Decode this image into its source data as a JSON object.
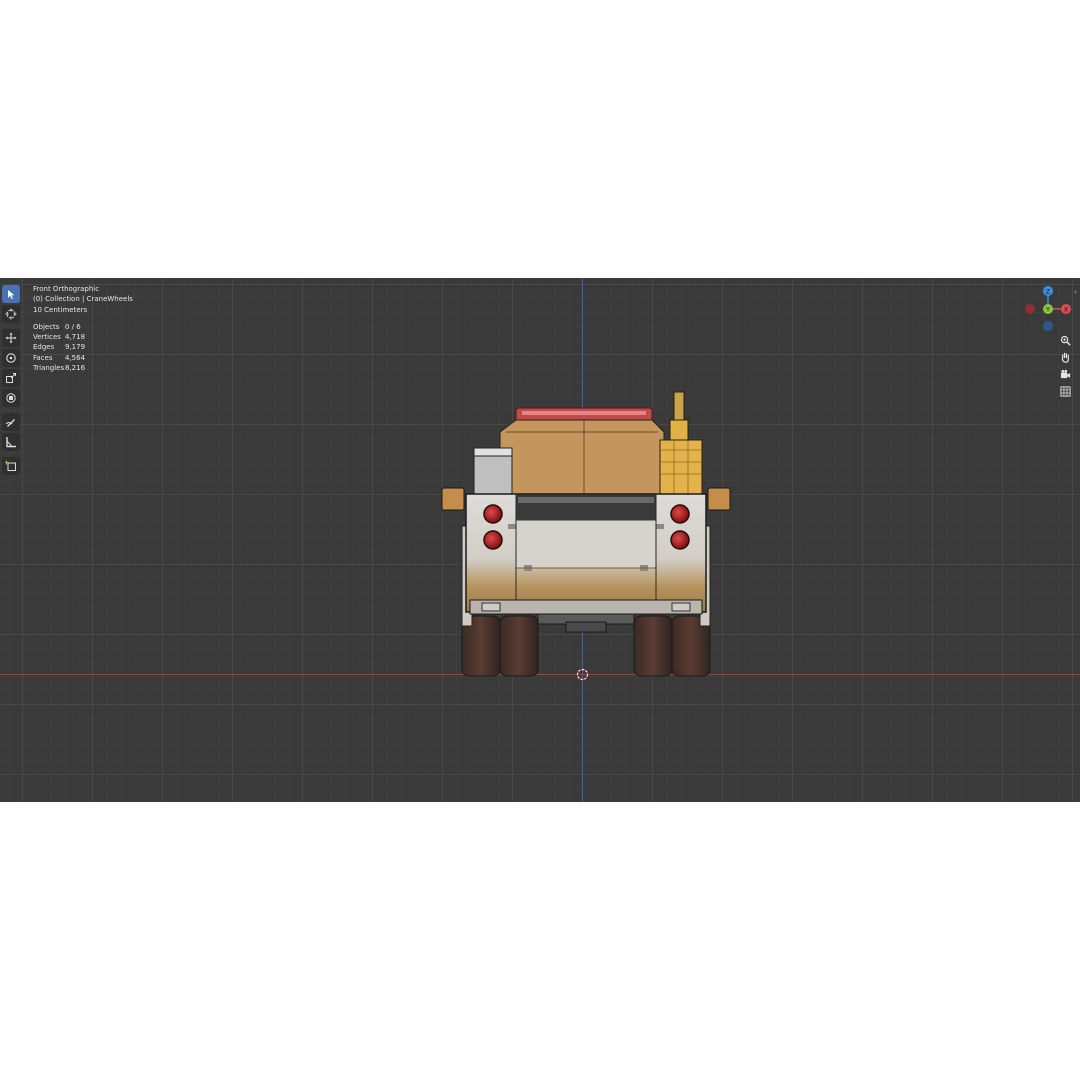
{
  "viewport": {
    "view_name": "Front Orthographic",
    "collection": "(0) Collection | CraneWheels",
    "scale": "10 Centimeters",
    "stats": [
      {
        "label": "Objects",
        "value": "0 / 6"
      },
      {
        "label": "Vertices",
        "value": "4,718"
      },
      {
        "label": "Edges",
        "value": "9,179"
      },
      {
        "label": "Faces",
        "value": "4,564"
      },
      {
        "label": "Triangles",
        "value": "8,216"
      }
    ]
  },
  "toolbar": {
    "tools": [
      "select-box-icon",
      "cursor-icon",
      "move-icon",
      "rotate-icon",
      "scale-icon",
      "transform-icon",
      "annotate-icon",
      "measure-icon",
      "add-cube-icon"
    ],
    "active": "select-box-icon"
  },
  "gizmo": {
    "z_label": "Z",
    "y_label": "Y",
    "x_label": "X",
    "colors": {
      "x": "#e04a4f",
      "y": "#8bc53f",
      "z": "#3c8fe0"
    }
  },
  "navigation": [
    "zoom-icon",
    "hand-pan-icon",
    "camera-icon",
    "grid-icon"
  ]
}
